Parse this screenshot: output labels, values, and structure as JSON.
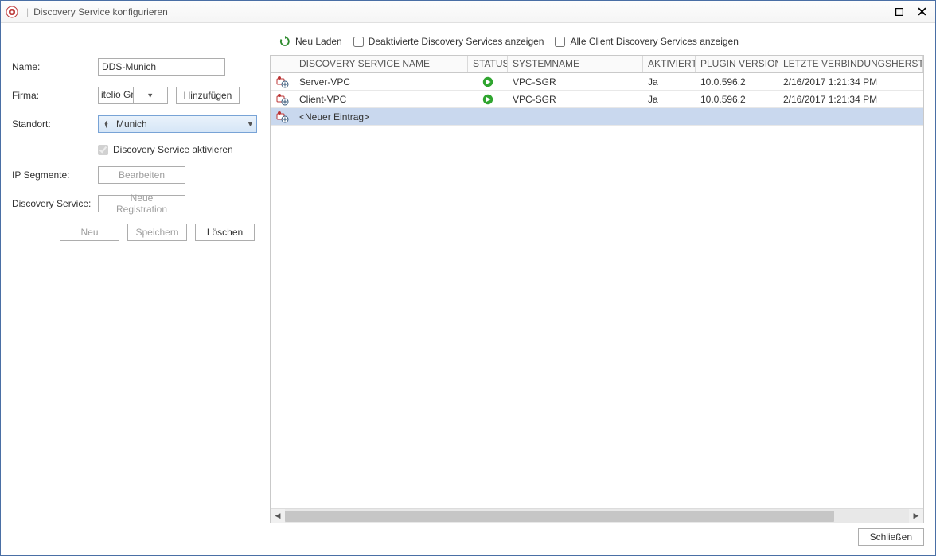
{
  "window": {
    "title": "Discovery Service konfigurieren"
  },
  "left": {
    "labels": {
      "name": "Name:",
      "firma": "Firma:",
      "standort": "Standort:",
      "ip": "IP Segmente:",
      "ds": "Discovery Service:"
    },
    "name_value": "DDS-Munich",
    "firma_value": "itelio GmbH",
    "hinzufuegen": "Hinzufügen",
    "standort_value": "Munich",
    "aktivieren": "Discovery Service aktivieren",
    "bearbeiten": "Bearbeiten",
    "neue_reg": "Neue Registration",
    "neu": "Neu",
    "speichern": "Speichern",
    "loeschen": "Löschen"
  },
  "toolbar": {
    "neu_laden": "Neu Laden",
    "deaktivierte": "Deaktivierte Discovery Services anzeigen",
    "alle_client": "Alle Client Discovery Services anzeigen"
  },
  "grid": {
    "headers": {
      "name": "DISCOVERY SERVICE NAME",
      "status": "STATUS",
      "system": "SYSTEMNAME",
      "aktiviert": "AKTIVIERT",
      "version": "PLUGIN VERSION",
      "date": "LETZTE VERBINDUNGSHERSTEL"
    },
    "rows": [
      {
        "name": "Server-VPC",
        "system": "VPC-SGR",
        "aktiviert": "Ja",
        "version": "10.0.596.2",
        "date": "2/16/2017 1:21:34 PM"
      },
      {
        "name": "Client-VPC",
        "system": "VPC-SGR",
        "aktiviert": "Ja",
        "version": "10.0.596.2",
        "date": "2/16/2017 1:21:34 PM"
      }
    ],
    "new_entry": "<Neuer Eintrag>"
  },
  "footer": {
    "close": "Schließen"
  }
}
